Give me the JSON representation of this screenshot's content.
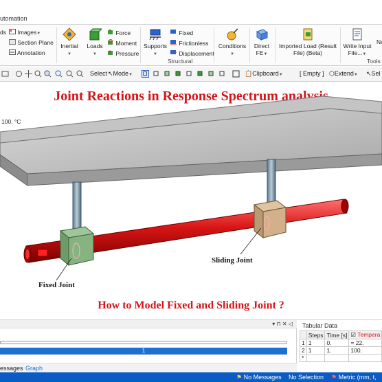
{
  "tab": {
    "automation": "utomation"
  },
  "ribbon": {
    "images": "Images",
    "ds": "ds",
    "section_plane": "Section Plane",
    "annotation": "Annotation",
    "inertial": "Inertial",
    "loads": "Loads",
    "force": "Force",
    "moment": "Moment",
    "pressure": "Pressure",
    "supports": "Supports",
    "fixed": "Fixed",
    "frictionless": "Frictionless",
    "displacement": "Displacement",
    "structural_group": "Structural",
    "conditions": "Conditions",
    "direct_fe": "Direct FE",
    "imported_load_1": "Imported Load (Result",
    "imported_load_2": "File) (Beta)",
    "write_input_1": "Write Input",
    "write_input_2": "File...",
    "tools_group": "Tools",
    "na": "Na"
  },
  "toolbar": {
    "select": "Select",
    "mode": "Mode",
    "clipboard": "Clipboard",
    "empty": "[ Empty ]",
    "extend": "Extend",
    "sel": "Sel"
  },
  "viewport": {
    "title": "Joint Reactions in Response Spectrum analysis",
    "temperature": "100. °C",
    "sliding_joint": "Sliding Joint",
    "fixed_joint": "Fixed Joint",
    "subtitle": "How to Model Fixed and Sliding Joint ?"
  },
  "graph": {
    "controls": "▾ ⊓ ✕ ◁",
    "step": "1",
    "tab_messages": "essages",
    "tab_graph": "Graph"
  },
  "tabular": {
    "title": "Tabular Data",
    "headers": [
      "",
      "Steps",
      "Time [s]",
      "Tempera"
    ],
    "rows": [
      [
        "1",
        "1",
        "0.",
        "= 22."
      ],
      [
        "2",
        "1",
        "1.",
        "100."
      ],
      [
        "*",
        "",
        "",
        ""
      ]
    ]
  },
  "status": {
    "messages": "No Messages",
    "selection": "No Selection",
    "units": "Metric (mm, t,"
  },
  "colors": {
    "title_red": "#d4151b",
    "status_blue": "#0a5bc4",
    "step_blue": "#1e6fd0"
  }
}
